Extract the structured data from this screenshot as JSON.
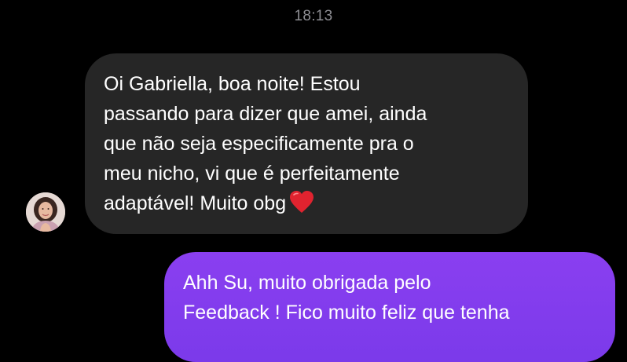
{
  "timestamp": "18:13",
  "incoming_message": {
    "lines": [
      "Oi Gabriella, boa noite! Estou",
      "passando para dizer que amei, ainda",
      "que não seja especificamente pra o",
      "meu nicho, vi que é perfeitamente",
      "adaptável! Muito obg"
    ],
    "emoji": "red-heart"
  },
  "outgoing_message": {
    "lines": [
      "Ahh Su, muito obrigada pelo",
      "Feedback ! Fico muito feliz que tenha"
    ]
  },
  "colors": {
    "background": "#000000",
    "incoming_bubble": "#262626",
    "outgoing_bubble": "#8a3ff0",
    "timestamp_text": "#8e8e93",
    "heart": "#e0232f"
  }
}
